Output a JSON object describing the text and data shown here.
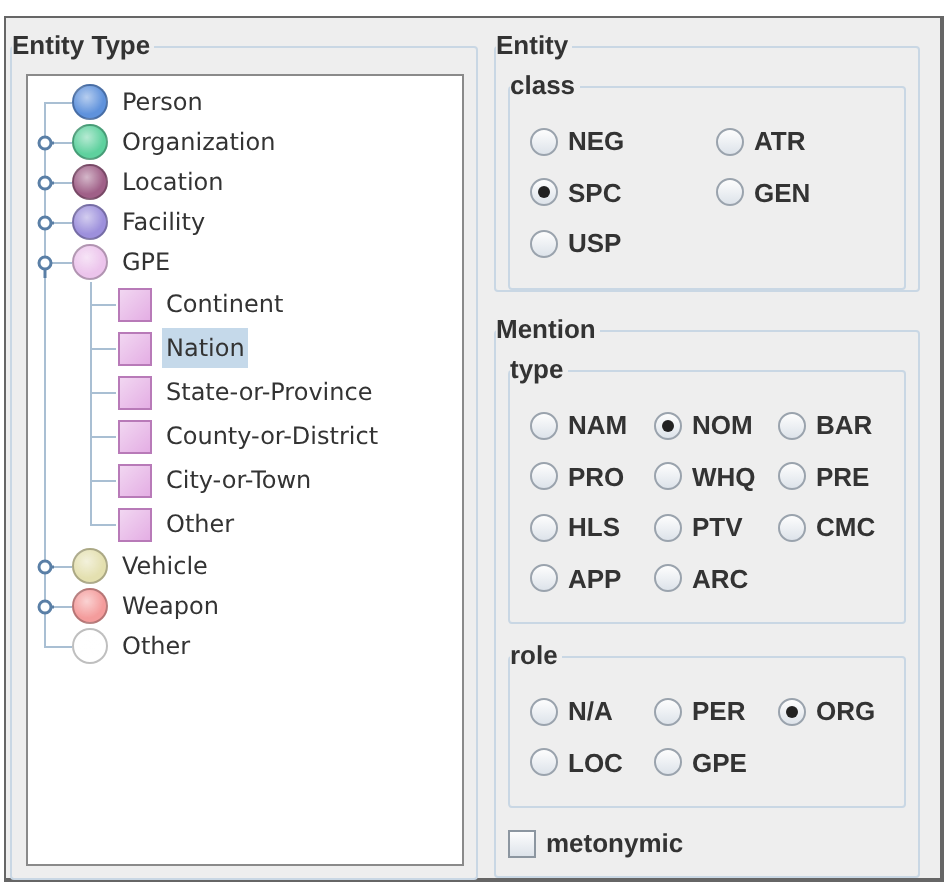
{
  "entity_type": {
    "title": "Entity Type",
    "tree": [
      {
        "label": "Person",
        "kind": "circle",
        "color": "#5f92dc",
        "selected": false
      },
      {
        "label": "Organization",
        "kind": "circle",
        "color": "#5ed19e",
        "selected": false,
        "expanded": false
      },
      {
        "label": "Location",
        "kind": "circle",
        "color": "#a06088",
        "selected": false,
        "expanded": false
      },
      {
        "label": "Facility",
        "kind": "circle",
        "color": "#9d90dc",
        "selected": false,
        "expanded": false
      },
      {
        "label": "GPE",
        "kind": "circle",
        "color": "#ecc4ec",
        "selected": false,
        "expanded": true,
        "children": [
          {
            "label": "Continent",
            "kind": "square",
            "color": "#e4aee4",
            "selected": false
          },
          {
            "label": "Nation",
            "kind": "square",
            "color": "#e4aee4",
            "selected": true
          },
          {
            "label": "State-or-Province",
            "kind": "square",
            "color": "#e4aee4",
            "selected": false
          },
          {
            "label": "County-or-District",
            "kind": "square",
            "color": "#e4aee4",
            "selected": false
          },
          {
            "label": "City-or-Town",
            "kind": "square",
            "color": "#e4aee4",
            "selected": false
          },
          {
            "label": "Other",
            "kind": "square",
            "color": "#e4aee4",
            "selected": false
          }
        ]
      },
      {
        "label": "Vehicle",
        "kind": "circle",
        "color": "#e4e0b0",
        "selected": false,
        "expanded": false
      },
      {
        "label": "Weapon",
        "kind": "circle",
        "color": "#f49c9c",
        "selected": false,
        "expanded": false
      },
      {
        "label": "Other",
        "kind": "circle",
        "color": "#ffffff",
        "selected": false
      }
    ]
  },
  "entity": {
    "title": "Entity",
    "groups": [
      {
        "title": "class",
        "options": [
          {
            "label": "NEG",
            "selected": false
          },
          {
            "label": "ATR",
            "selected": false
          },
          {
            "label": "SPC",
            "selected": true
          },
          {
            "label": "GEN",
            "selected": false
          },
          {
            "label": "USP",
            "selected": false
          }
        ]
      }
    ]
  },
  "mention": {
    "title": "Mention",
    "groups": [
      {
        "title": "type",
        "options": [
          {
            "label": "NAM",
            "selected": false
          },
          {
            "label": "NOM",
            "selected": true
          },
          {
            "label": "BAR",
            "selected": false
          },
          {
            "label": "PRO",
            "selected": false
          },
          {
            "label": "WHQ",
            "selected": false
          },
          {
            "label": "PRE",
            "selected": false
          },
          {
            "label": "HLS",
            "selected": false
          },
          {
            "label": "PTV",
            "selected": false
          },
          {
            "label": "CMC",
            "selected": false
          },
          {
            "label": "APP",
            "selected": false
          },
          {
            "label": "ARC",
            "selected": false
          }
        ]
      },
      {
        "title": "role",
        "options": [
          {
            "label": "N/A",
            "selected": false
          },
          {
            "label": "PER",
            "selected": false
          },
          {
            "label": "ORG",
            "selected": true
          },
          {
            "label": "LOC",
            "selected": false
          },
          {
            "label": "GPE",
            "selected": false
          }
        ]
      }
    ],
    "metonymic": {
      "label": "metonymic",
      "checked": false
    }
  }
}
